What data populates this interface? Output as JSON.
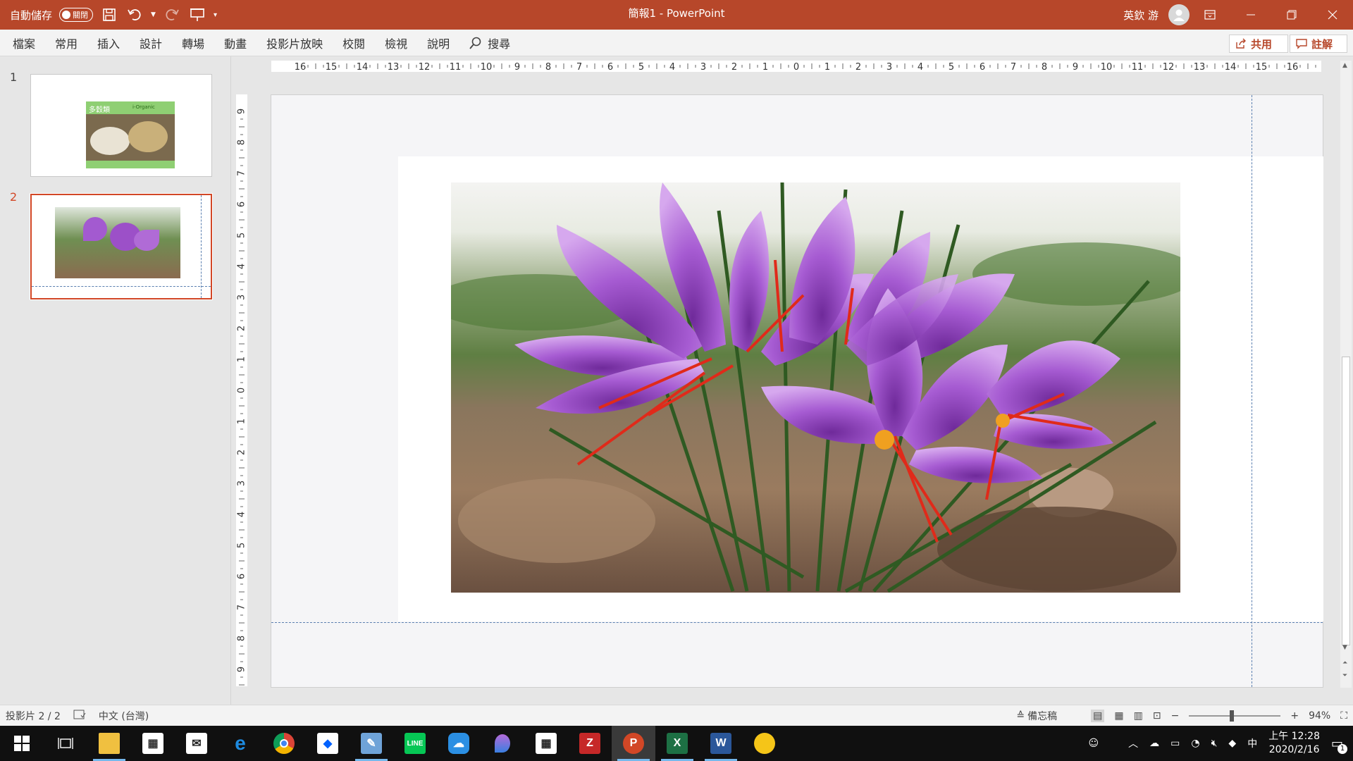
{
  "titlebar": {
    "autosave_label": "自動儲存",
    "autosave_state": "關閉",
    "doc_title": "簡報1 - PowerPoint",
    "user_name": "英欽 游"
  },
  "menu": {
    "tabs": [
      "檔案",
      "常用",
      "插入",
      "設計",
      "轉場",
      "動畫",
      "投影片放映",
      "校閱",
      "檢視",
      "說明"
    ],
    "search_label": "搜尋",
    "share_label": "共用",
    "comments_label": "註解"
  },
  "thumbnails": {
    "numbers": [
      "1",
      "2"
    ],
    "slide1_title": "多穀類",
    "slide1_badge": "i-Organic",
    "selected_slide": 2
  },
  "ruler": {
    "horizontal": [
      "16",
      "15",
      "14",
      "13",
      "12",
      "11",
      "10",
      "9",
      "8",
      "7",
      "6",
      "5",
      "4",
      "3",
      "2",
      "1",
      "0",
      "1",
      "2",
      "3",
      "4",
      "5",
      "6",
      "7",
      "8",
      "9",
      "10",
      "11",
      "12",
      "13",
      "14",
      "15",
      "16"
    ],
    "vertical": [
      "9",
      "8",
      "7",
      "6",
      "5",
      "4",
      "3",
      "2",
      "1",
      "0",
      "1",
      "2",
      "3",
      "4",
      "5",
      "6",
      "7",
      "8",
      "9"
    ]
  },
  "status": {
    "slide_info": "投影片 2 / 2",
    "language": "中文 (台灣)",
    "notes_label": "備忘稿",
    "zoom": "94%"
  },
  "taskbar": {
    "time": "上午 12:28",
    "date": "2020/2/16",
    "ime": "中",
    "notification_count": "1"
  },
  "colors": {
    "accent": "#b7472a",
    "selection": "#d24726",
    "taskbar": "#101010"
  }
}
